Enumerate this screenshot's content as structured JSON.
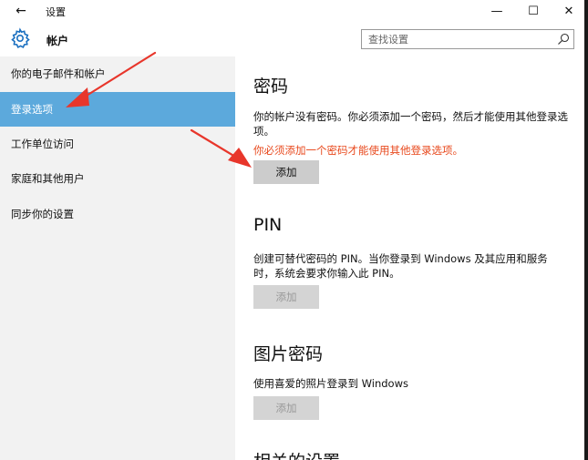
{
  "titlebar": {
    "back_icon": "←",
    "title": "设置",
    "minimize_icon": "—",
    "maximize_icon": "☐",
    "close_icon": "✕"
  },
  "header": {
    "title": "帐户",
    "search_placeholder": "查找设置"
  },
  "sidebar": {
    "items": [
      {
        "label": "你的电子邮件和帐户",
        "active": false
      },
      {
        "label": "登录选项",
        "active": true
      },
      {
        "label": "工作单位访问",
        "active": false
      },
      {
        "label": "家庭和其他用户",
        "active": false
      },
      {
        "label": "同步你的设置",
        "active": false
      }
    ]
  },
  "main": {
    "password": {
      "heading": "密码",
      "description": "你的帐户没有密码。你必须添加一个密码，然后才能使用其他登录选项。",
      "warning": "你必须添加一个密码才能使用其他登录选项。",
      "button_label": "添加"
    },
    "pin": {
      "heading": "PIN",
      "description": "创建可替代密码的 PIN。当你登录到 Windows 及其应用和服务时，系统会要求你输入此 PIN。",
      "button_label": "添加"
    },
    "picture_password": {
      "heading": "图片密码",
      "description": "使用喜爱的照片登录到 Windows",
      "button_label": "添加"
    },
    "related_settings": {
      "heading": "相关的设置"
    }
  },
  "colors": {
    "accent": "#5ca9dc",
    "sidebar_bg": "#f2f2f2",
    "warning": "#e8481c",
    "button_bg": "#cccccc",
    "annotation_arrow": "#e8362b"
  }
}
